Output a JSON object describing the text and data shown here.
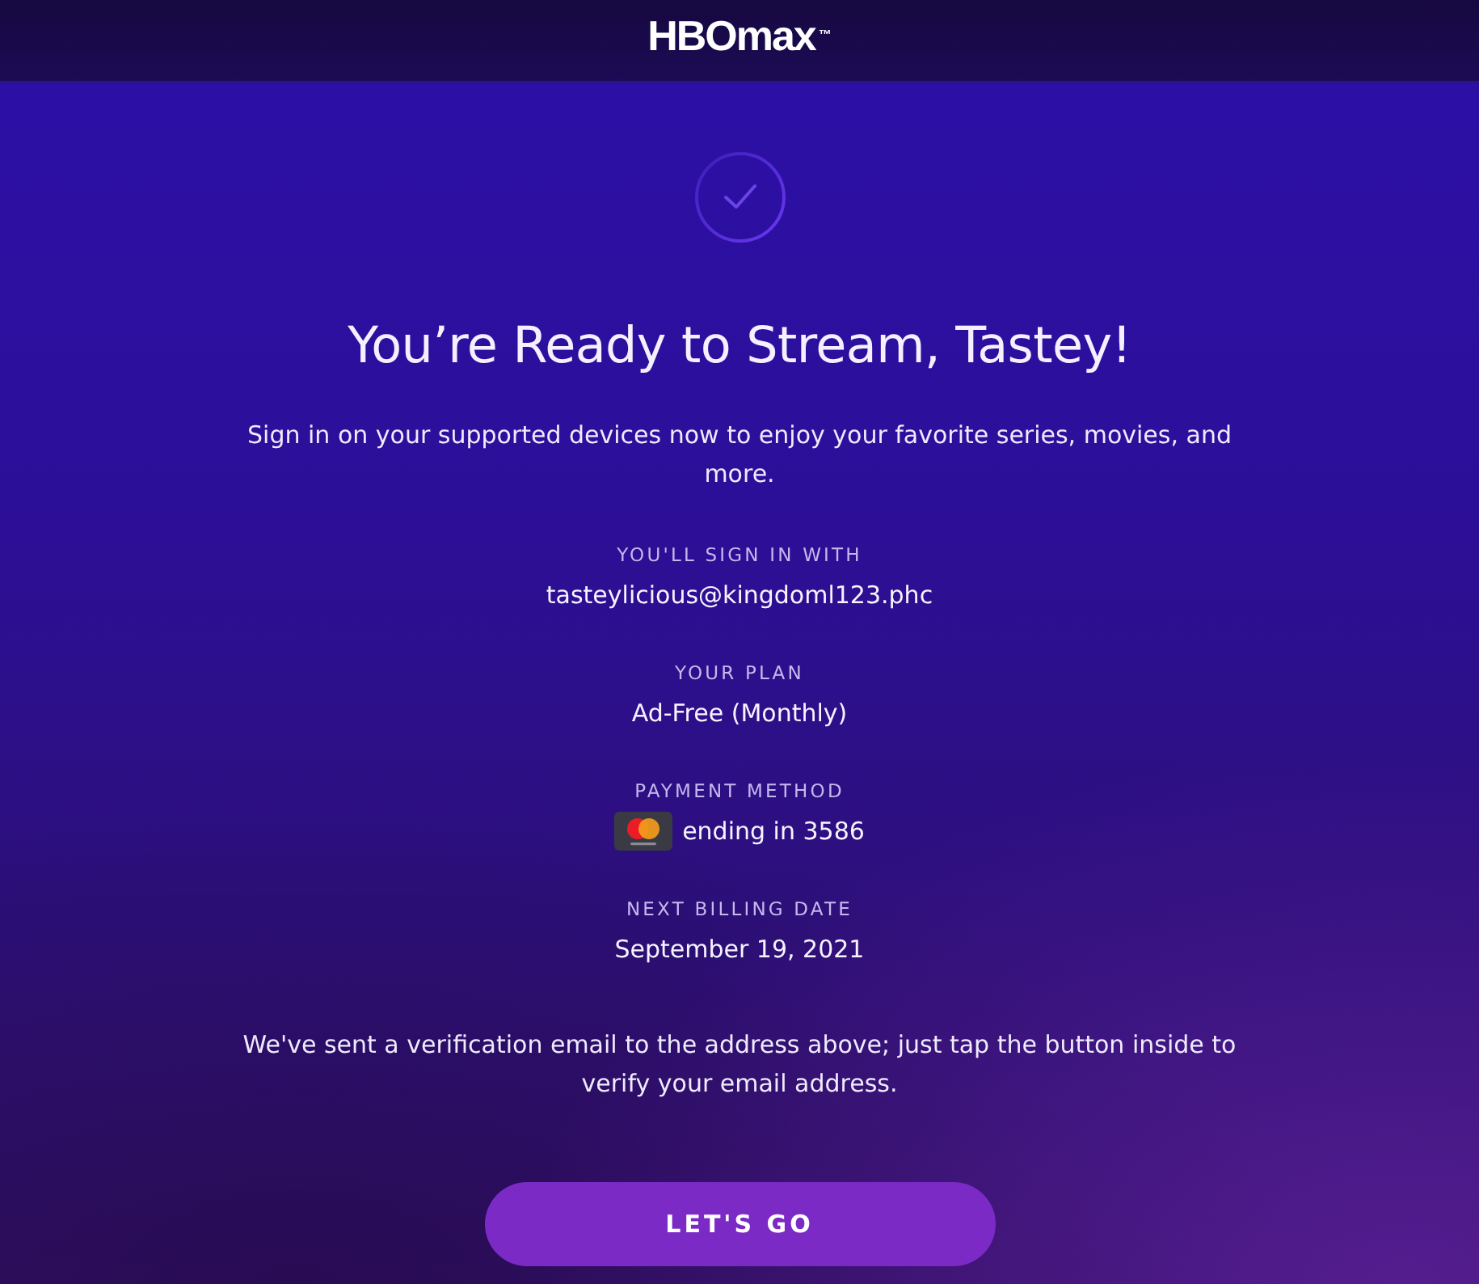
{
  "header": {
    "logo": "HBOmax$^{™}$"
  },
  "confirmation": {
    "title": "You’re Ready to Stream, Tastey!",
    "message": "Sign in on your supported devices now to enjoy your favorite series, movies, and more.",
    "details": [
      {
        "kind": "text",
        "label": "YOU'LL SIGN IN WITH",
        "value": "tasteylicious@kingdoml123.phc"
      },
      {
        "kind": "text",
        "label": "YOUR PLAN",
        "value": "Ad-Free (Monthly)"
      },
      {
        "kind": "card",
        "label": "PAYMENT METHOD",
        "value": "ending in 3586"
      },
      {
        "kind": "text",
        "label": "NEXT BILLING DATE",
        "value": "September 19, 2021"
      }
    ],
    "note": "We've sent a verification email to the address above; just tap the button inside to verify your email address.",
    "button": "LET'S GO"
  }
}
